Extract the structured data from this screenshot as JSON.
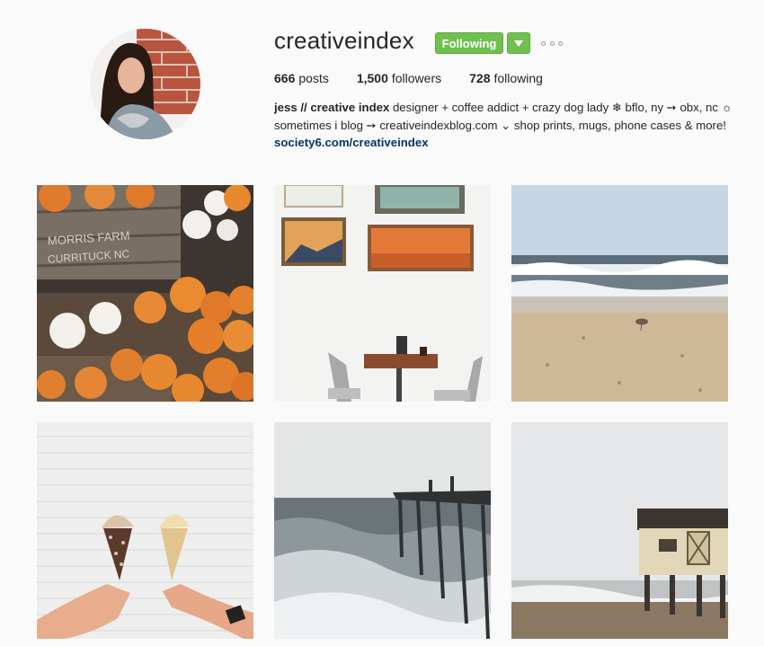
{
  "profile": {
    "username": "creativeindex",
    "follow_button_label": "Following",
    "avatar_alt": "profile photo"
  },
  "stats": {
    "posts_count": "666",
    "posts_label": "posts",
    "followers_count": "1,500",
    "followers_label": "followers",
    "following_count": "728",
    "following_label": "following"
  },
  "bio": {
    "name": "jess // creative index",
    "text": "designer + coffee addict + crazy dog lady ❄ bflo, ny ➙ obx, nc ☼ sometimes i blog ➙ creativeindexblog.com ⌄ shop prints, mugs, phone cases & more!",
    "link": "society6.com/creativeindex"
  },
  "posts": [
    {
      "subject": "pumpkins-in-crates"
    },
    {
      "subject": "cafe-table-with-paintings"
    },
    {
      "subject": "beach-with-waves-and-bird"
    },
    {
      "subject": "ice-cream-cones"
    },
    {
      "subject": "pier-in-stormy-sea"
    },
    {
      "subject": "beach-house-on-stilts"
    }
  ],
  "colors": {
    "follow_green": "#70c050",
    "link_blue": "#003569",
    "background": "#fafafa"
  }
}
